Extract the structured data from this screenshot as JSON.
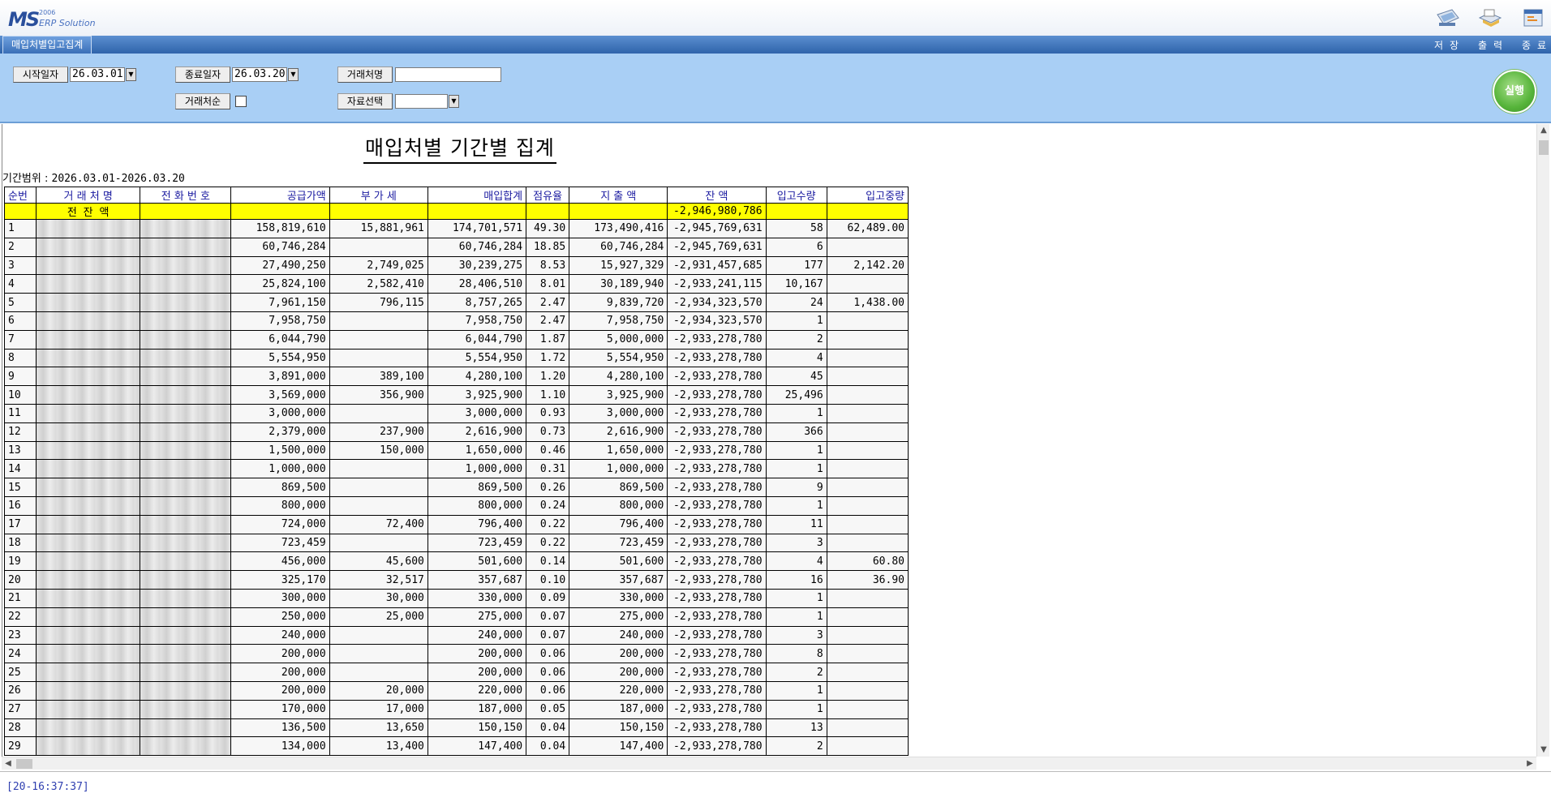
{
  "app": {
    "logo_mark": "MS",
    "logo_year": "2006",
    "logo_sub": "ERP Solution"
  },
  "toolbar": {
    "save_label": "저장",
    "print_label": "출력",
    "exit_label": "종료"
  },
  "tab": {
    "label": "매입처별입고집계"
  },
  "filters": {
    "start_label": "시작일자",
    "start_value": "26.03.01",
    "end_label": "종료일자",
    "end_value": "26.03.20",
    "vendor_name_label": "거래처명",
    "vendor_name_value": "",
    "vendor_order_label": "거래처순",
    "data_select_label": "자료선택",
    "data_select_value": "",
    "run_label": "실행"
  },
  "report": {
    "title": "매입처별 기간별 집계",
    "period_label": "기간범위 :",
    "period_value": "2026.03.01-2026.03.20",
    "columns": [
      "순번",
      "거 래 처 명",
      "전 화 번 호",
      "공급가액",
      "부 가 세",
      "매입합계",
      "점유율",
      "지 출 액",
      "잔 액",
      "입고수량",
      "입고중량"
    ],
    "carry_label": "전 잔 액",
    "carry_balance": "-2,946,980,786",
    "rows": [
      [
        "1",
        "158,819,610",
        "15,881,961",
        "174,701,571",
        "49.30",
        "173,490,416",
        "-2,945,769,631",
        "58",
        "62,489.00"
      ],
      [
        "2",
        "60,746,284",
        "",
        "60,746,284",
        "18.85",
        "60,746,284",
        "-2,945,769,631",
        "6",
        ""
      ],
      [
        "3",
        "27,490,250",
        "2,749,025",
        "30,239,275",
        "8.53",
        "15,927,329",
        "-2,931,457,685",
        "177",
        "2,142.20"
      ],
      [
        "4",
        "25,824,100",
        "2,582,410",
        "28,406,510",
        "8.01",
        "30,189,940",
        "-2,933,241,115",
        "10,167",
        ""
      ],
      [
        "5",
        "7,961,150",
        "796,115",
        "8,757,265",
        "2.47",
        "9,839,720",
        "-2,934,323,570",
        "24",
        "1,438.00"
      ],
      [
        "6",
        "7,958,750",
        "",
        "7,958,750",
        "2.47",
        "7,958,750",
        "-2,934,323,570",
        "1",
        ""
      ],
      [
        "7",
        "6,044,790",
        "",
        "6,044,790",
        "1.87",
        "5,000,000",
        "-2,933,278,780",
        "2",
        ""
      ],
      [
        "8",
        "5,554,950",
        "",
        "5,554,950",
        "1.72",
        "5,554,950",
        "-2,933,278,780",
        "4",
        ""
      ],
      [
        "9",
        "3,891,000",
        "389,100",
        "4,280,100",
        "1.20",
        "4,280,100",
        "-2,933,278,780",
        "45",
        ""
      ],
      [
        "10",
        "3,569,000",
        "356,900",
        "3,925,900",
        "1.10",
        "3,925,900",
        "-2,933,278,780",
        "25,496",
        ""
      ],
      [
        "11",
        "3,000,000",
        "",
        "3,000,000",
        "0.93",
        "3,000,000",
        "-2,933,278,780",
        "1",
        ""
      ],
      [
        "12",
        "2,379,000",
        "237,900",
        "2,616,900",
        "0.73",
        "2,616,900",
        "-2,933,278,780",
        "366",
        ""
      ],
      [
        "13",
        "1,500,000",
        "150,000",
        "1,650,000",
        "0.46",
        "1,650,000",
        "-2,933,278,780",
        "1",
        ""
      ],
      [
        "14",
        "1,000,000",
        "",
        "1,000,000",
        "0.31",
        "1,000,000",
        "-2,933,278,780",
        "1",
        ""
      ],
      [
        "15",
        "869,500",
        "",
        "869,500",
        "0.26",
        "869,500",
        "-2,933,278,780",
        "9",
        ""
      ],
      [
        "16",
        "800,000",
        "",
        "800,000",
        "0.24",
        "800,000",
        "-2,933,278,780",
        "1",
        ""
      ],
      [
        "17",
        "724,000",
        "72,400",
        "796,400",
        "0.22",
        "796,400",
        "-2,933,278,780",
        "11",
        ""
      ],
      [
        "18",
        "723,459",
        "",
        "723,459",
        "0.22",
        "723,459",
        "-2,933,278,780",
        "3",
        ""
      ],
      [
        "19",
        "456,000",
        "45,600",
        "501,600",
        "0.14",
        "501,600",
        "-2,933,278,780",
        "4",
        "60.80"
      ],
      [
        "20",
        "325,170",
        "32,517",
        "357,687",
        "0.10",
        "357,687",
        "-2,933,278,780",
        "16",
        "36.90"
      ],
      [
        "21",
        "300,000",
        "30,000",
        "330,000",
        "0.09",
        "330,000",
        "-2,933,278,780",
        "1",
        ""
      ],
      [
        "22",
        "250,000",
        "25,000",
        "275,000",
        "0.07",
        "275,000",
        "-2,933,278,780",
        "1",
        ""
      ],
      [
        "23",
        "240,000",
        "",
        "240,000",
        "0.07",
        "240,000",
        "-2,933,278,780",
        "3",
        ""
      ],
      [
        "24",
        "200,000",
        "",
        "200,000",
        "0.06",
        "200,000",
        "-2,933,278,780",
        "8",
        ""
      ],
      [
        "25",
        "200,000",
        "",
        "200,000",
        "0.06",
        "200,000",
        "-2,933,278,780",
        "2",
        ""
      ],
      [
        "26",
        "200,000",
        "20,000",
        "220,000",
        "0.06",
        "220,000",
        "-2,933,278,780",
        "1",
        ""
      ],
      [
        "27",
        "170,000",
        "17,000",
        "187,000",
        "0.05",
        "187,000",
        "-2,933,278,780",
        "1",
        ""
      ],
      [
        "28",
        "136,500",
        "13,650",
        "150,150",
        "0.04",
        "150,150",
        "-2,933,278,780",
        "13",
        ""
      ],
      [
        "29",
        "134,000",
        "13,400",
        "147,400",
        "0.04",
        "147,400",
        "-2,933,278,780",
        "2",
        ""
      ]
    ]
  },
  "status": {
    "text": "[20-16:37:37]"
  },
  "colors": {
    "panel": "#a9cff5",
    "tab": "#2f64ab",
    "carry_row": "#ffff00",
    "header_text": "#1a1aa0",
    "run": "#56b43a"
  }
}
